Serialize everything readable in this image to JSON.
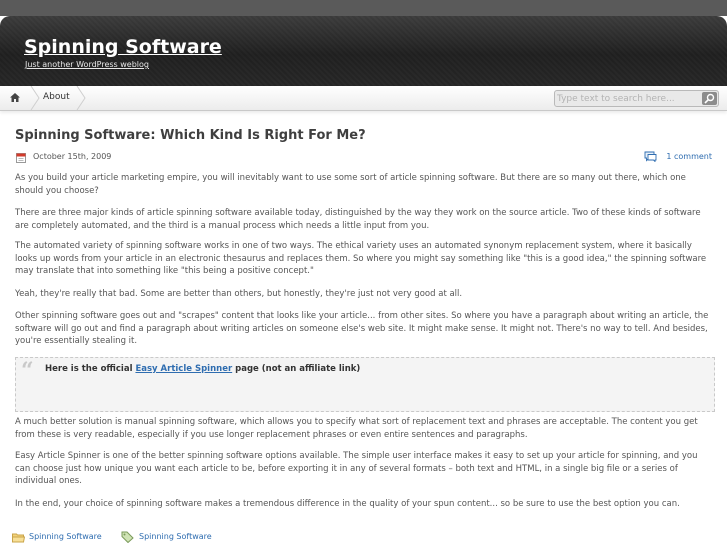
{
  "header": {
    "title": "Spinning Software",
    "tagline": "Just another WordPress weblog"
  },
  "nav": {
    "home_icon": "home-icon",
    "items": [
      {
        "label": "About"
      }
    ]
  },
  "search": {
    "placeholder": "Type text to search here...",
    "button_icon": "magnifier-icon"
  },
  "post": {
    "title": "Spinning Software: Which Kind Is Right For Me?",
    "date": "October 15th, 2009",
    "comments": "1 comment",
    "paragraphs": [
      "As you build your article marketing empire, you will inevitably want to use some sort of article spinning software. But there are so many out there, which one should you choose?",
      "There are three major kinds of article spinning software available today, distinguished by the way they work on the source article. Two of these kinds of software are completely automated, and the third is a manual process which needs a little input from you.",
      "The automated variety of spinning software works in one of two ways. The ethical variety uses an automated synonym replacement system, where it basically looks up words from your article in an electronic thesaurus and replaces them. So where you might say something like \"this is a good idea,\" the spinning software may translate that into something like \"this being a positive concept.\"",
      "Yeah, they're really that bad. Some are better than others, but honestly, they're just not very good at all.",
      "Other spinning software goes out and \"scrapes\" content that looks like your article... from other sites. So where you have a paragraph about writing an article, the software will go out and find a paragraph about writing articles on someone else's web site. It might make sense. It might not. There's no way to tell. And besides, you're essentially stealing it.",
      "A much better solution is manual spinning software, which allows you to specify what sort of replacement text and phrases are acceptable. The content you get from these is very readable, especially if you use longer replacement phrases or even entire sentences and paragraphs.",
      "Easy Article Spinner is one of the better spinning software options available. The simple user interface makes it easy to set up your article for spinning, and you can choose just how unique you want each article to be, before exporting it in any of several formats – both text and HTML, in a single big file or a series of individual ones.",
      "In the end, your choice of spinning software makes a tremendous difference in the quality of your spun content... so be sure to use the best option you can."
    ],
    "quote": {
      "prefix": "Here is the official ",
      "link": "Easy Article Spinner",
      "suffix": " page (not an affiliate link)"
    },
    "category": "Spinning Software",
    "tag": "Spinning Software"
  },
  "colors": {
    "link": "#2f6db0",
    "header_bg": "#262626"
  }
}
